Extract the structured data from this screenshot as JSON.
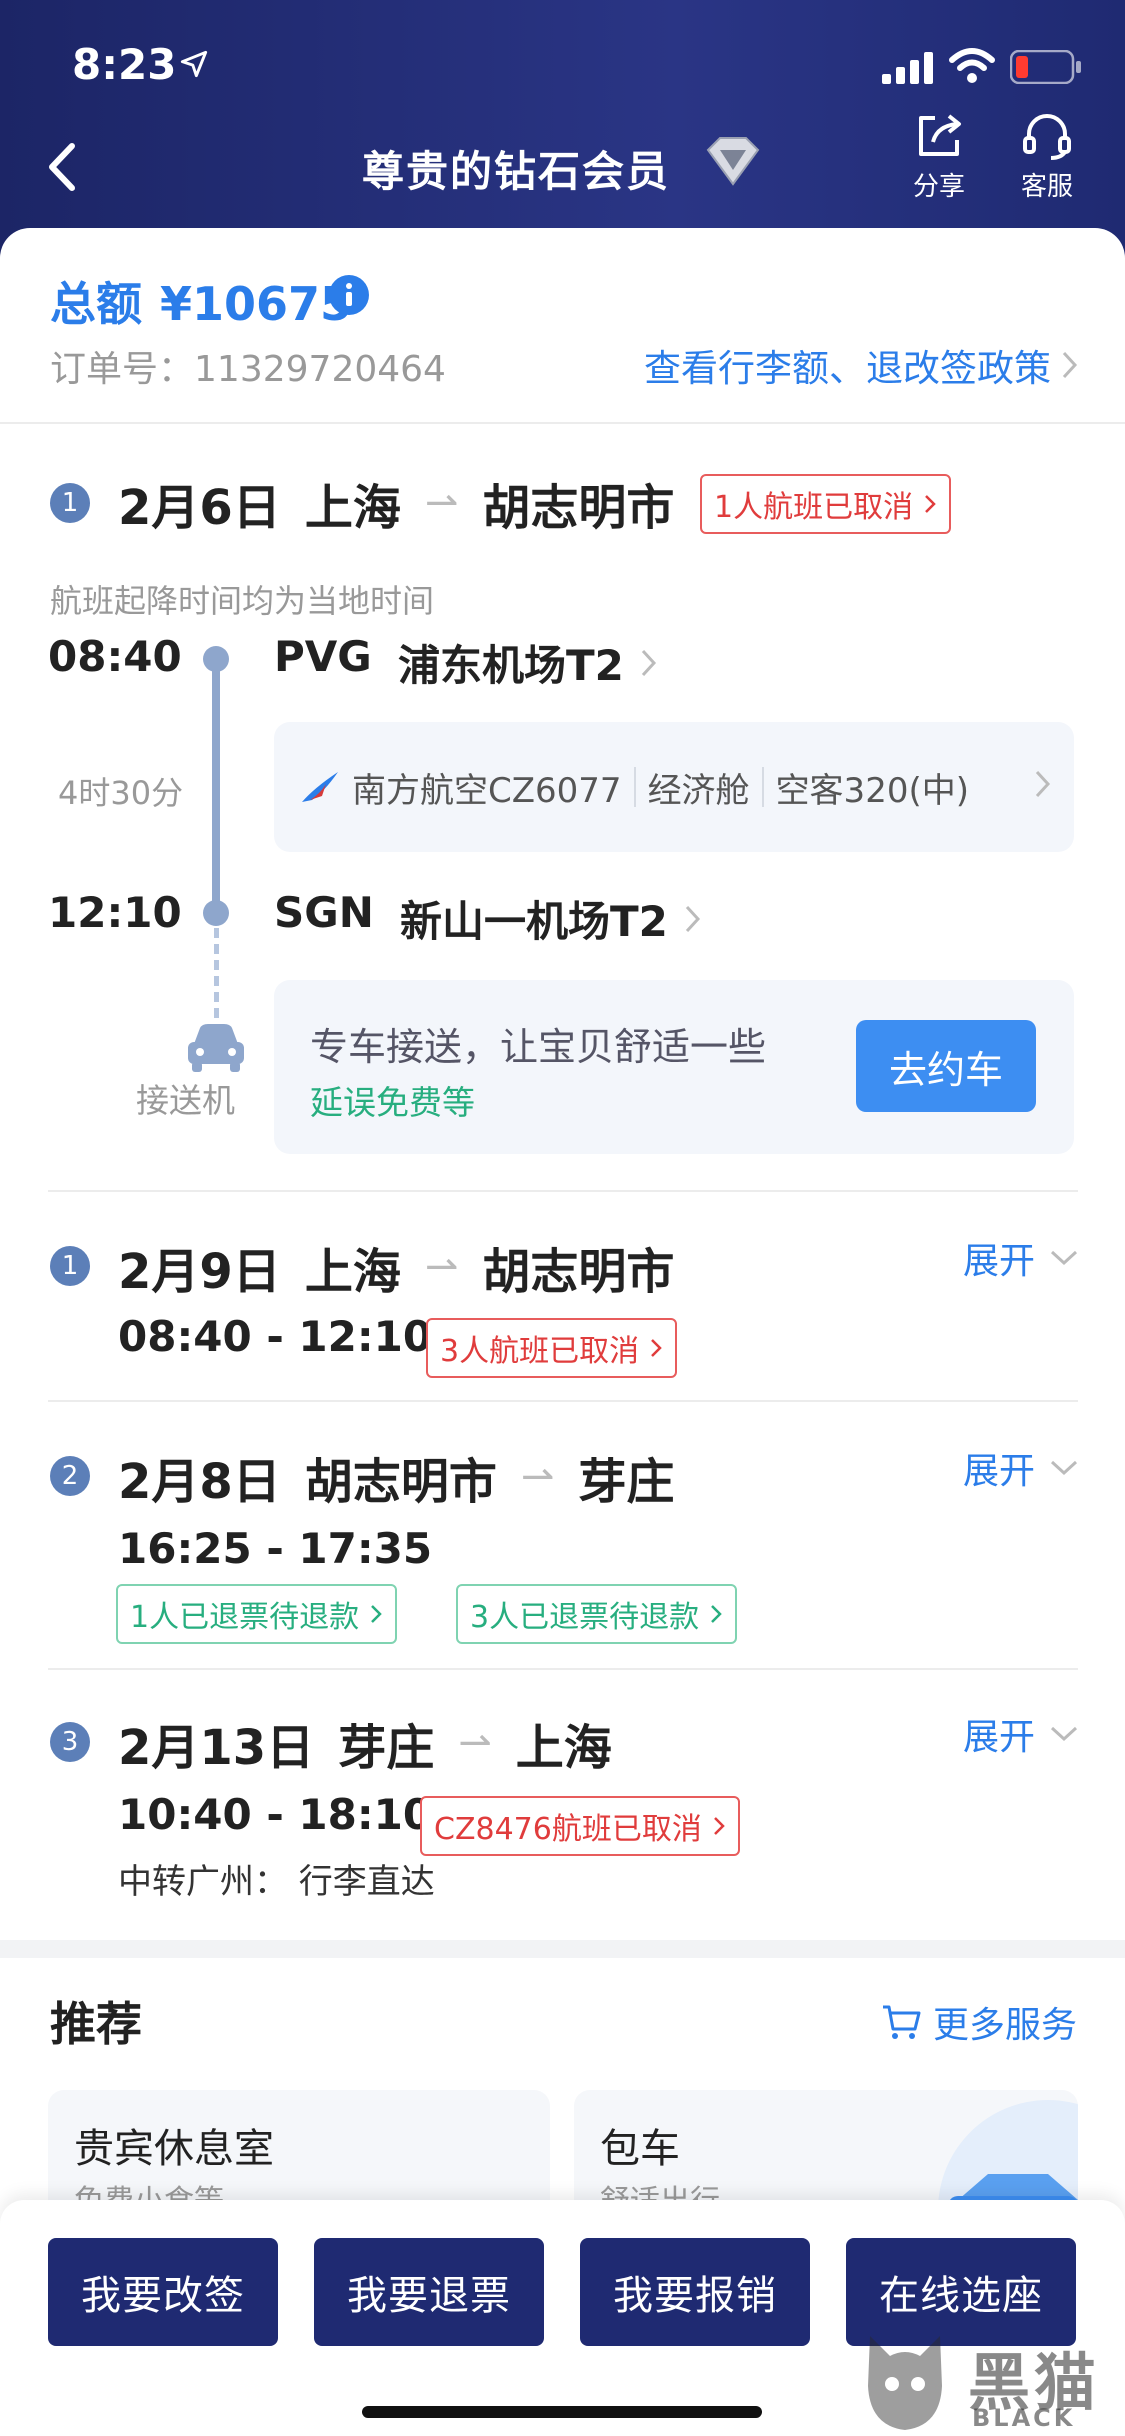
{
  "status_bar": {
    "time": "8:23"
  },
  "nav": {
    "title": "尊贵的钻石会员",
    "share_label": "分享",
    "service_label": "客服"
  },
  "order": {
    "total_label": "总额",
    "total_amount": "¥10675",
    "order_no_label": "订单号：",
    "order_no": "11329720464",
    "policy_link": "查看行李额、退改签政策"
  },
  "segments": [
    {
      "index": "1",
      "date": "2月6日",
      "from": "上海",
      "to": "胡志明市",
      "badge": "1人航班已取消",
      "local_note": "航班起降时间均为当地时间",
      "dep_time": "08:40",
      "dep_code": "PVG",
      "dep_airport": "浦东机场T2",
      "duration": "4时30分",
      "airline": "南方航空CZ6077",
      "cabin": "经济舱",
      "aircraft": "空客320(中)",
      "arr_time": "12:10",
      "arr_code": "SGN",
      "arr_airport": "新山一机场T2",
      "pickup_icon_label": "接送机",
      "pickup_title": "专车接送，让宝贝舒适一些",
      "pickup_sub": "延误免费等",
      "pickup_button": "去约车"
    },
    {
      "index": "1",
      "date": "2月9日",
      "from": "上海",
      "to": "胡志明市",
      "times": "08:40 - 12:10",
      "badge": "3人航班已取消",
      "expand": "展开"
    },
    {
      "index": "2",
      "date": "2月8日",
      "from": "胡志明市",
      "to": "芽庄",
      "times": "16:25 - 17:35",
      "badge1": "1人已退票待退款",
      "badge2": "3人已退票待退款",
      "expand": "展开"
    },
    {
      "index": "3",
      "date": "2月13日",
      "from": "芽庄",
      "to": "上海",
      "times": "10:40 - 18:10",
      "badge": "CZ8476航班已取消",
      "transfer": "中转广州： 行李直达",
      "expand": "展开"
    }
  ],
  "recommend": {
    "title": "推荐",
    "more": "更多服务",
    "cards": [
      {
        "title": "贵宾休息室",
        "sub": "免费小食等"
      },
      {
        "title": "包车",
        "sub": "舒适出行"
      }
    ]
  },
  "actions": [
    "我要改签",
    "我要退票",
    "我要报销",
    "在线选座"
  ],
  "watermark": {
    "text": "黑猫",
    "sub": "BLACK CAT"
  },
  "colors": {
    "header": "#1f2a72",
    "accent": "#2b7de9",
    "cancel": "#e03c3c",
    "refund": "#27ae7f"
  }
}
